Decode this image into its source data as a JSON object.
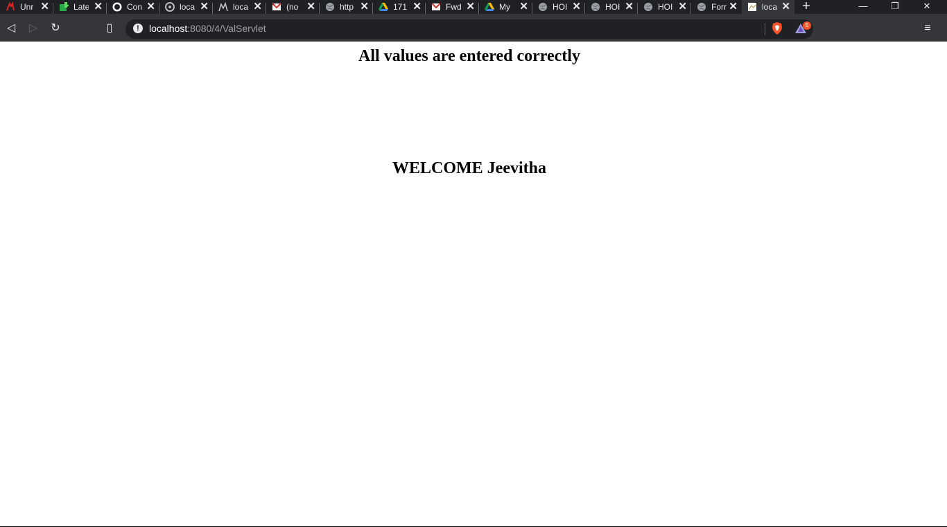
{
  "browser": {
    "tabs": [
      {
        "title": "Unr",
        "icon": "pdf-icon"
      },
      {
        "title": "Late",
        "icon": "puzzle-icon"
      },
      {
        "title": "Con",
        "icon": "github-icon"
      },
      {
        "title": "loca",
        "icon": "settings-icon"
      },
      {
        "title": "loca",
        "icon": "tomcat-icon"
      },
      {
        "title": "(no",
        "icon": "gmail-icon"
      },
      {
        "title": "http",
        "icon": "globe-icon"
      },
      {
        "title": "171",
        "icon": "drive-icon"
      },
      {
        "title": "Fwd",
        "icon": "gmail-icon"
      },
      {
        "title": "My",
        "icon": "drive-icon"
      },
      {
        "title": "HOI",
        "icon": "globe-icon"
      },
      {
        "title": "HOI",
        "icon": "globe-icon"
      },
      {
        "title": "HOI",
        "icon": "globe-icon"
      },
      {
        "title": "Forr",
        "icon": "globe-icon"
      },
      {
        "title": "loca",
        "icon": "page-icon"
      }
    ],
    "url_host": "localhost",
    "url_rest": ":8080/4/ValServlet",
    "rewards_badge": "5"
  },
  "page": {
    "status_message": "All values are entered correctly",
    "welcome_message": "WELCOME Jeevitha"
  }
}
